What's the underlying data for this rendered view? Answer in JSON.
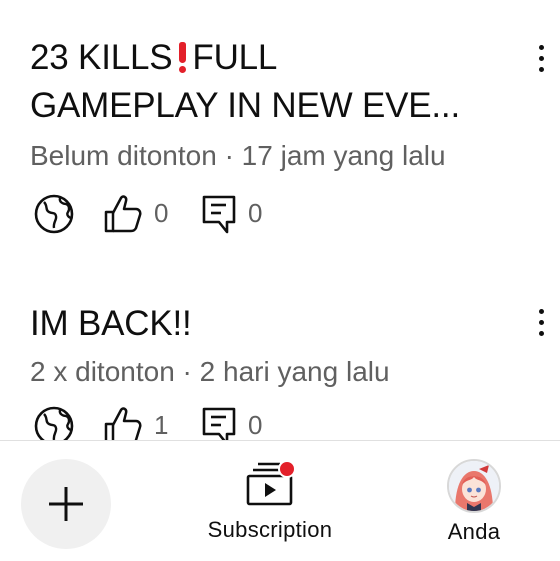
{
  "videos": [
    {
      "title_line1": "23 KILLS",
      "title_line1b": "FULL",
      "title_line2": "GAMEPLAY IN NEW EVE...",
      "meta": "Belum ditonton · 17 jam yang lalu",
      "likes": "0",
      "comments": "0"
    },
    {
      "title_line1": "IM BACK!!",
      "meta": "2 x ditonton · 2 hari yang lalu",
      "likes": "1",
      "comments": "0"
    }
  ],
  "bottom_nav": {
    "create_icon": "plus-icon",
    "subscription_label": "Subscription",
    "you_label": "Anda"
  },
  "colors": {
    "accent_red": "#e3202a",
    "secondary_text": "#606060",
    "primary_text": "#0f0f0f"
  }
}
